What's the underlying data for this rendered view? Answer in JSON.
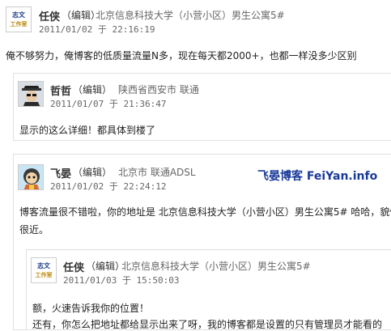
{
  "comment1": {
    "name": "任侠",
    "edit": "（编辑）",
    "location": "北京信息科技大学（小营小区）男生公寓5#",
    "time": "2011/01/02 于 22:16:19",
    "body": "俺不够努力，俺博客的低质量流量N多，现在每天都2000+，也都一样没多少区别",
    "avatar_line1": "志文",
    "avatar_line2": "工作室"
  },
  "reply1": {
    "name": "哲哲",
    "edit": "（编辑）",
    "location": "陕西省西安市 联通",
    "time": "2011/01/07 于 21:36:47",
    "body": "显示的这么详细！都具体到楼了"
  },
  "comment2": {
    "name": "飞晏",
    "edit": "（编辑）",
    "location": "北京市 联通ADSL",
    "time": "2011/01/02 于 22:24:12",
    "body_line1": "博客流量很不错啦，你的地址是 北京信息科技大学（小营小区）男生公寓5# 哈哈，貌似",
    "body_line2": "很近。"
  },
  "watermark": {
    "text": "飞晏博客 FeiYan.info"
  },
  "reply2": {
    "name": "任侠",
    "edit": "（编辑）",
    "location": "北京信息科技大学（小营小区）男生公寓5#",
    "time": "2011/01/03 于 15:50:03",
    "body_line1": "额，火速告诉我你的位置！",
    "body_line2": "还有，你怎么把地址都给显示出来了呀，我的博客都是设置的只有管理员才能看的",
    "avatar_line1": "志文",
    "avatar_line2": "工作室"
  }
}
